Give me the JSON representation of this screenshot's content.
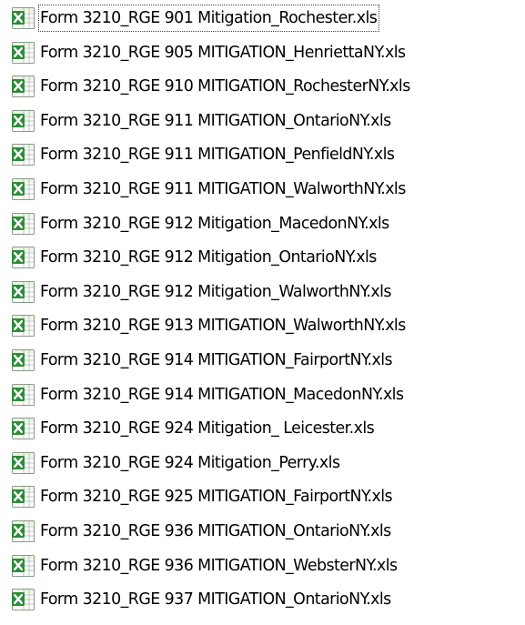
{
  "file_list": {
    "file_icon": "excel-spreadsheet-icon",
    "colors": {
      "icon_green": "#2e8b3a",
      "icon_light": "#eaf5e4",
      "text": "#000000"
    },
    "focused_index": 0,
    "items": [
      {
        "name": "Form 3210_RGE 901 Mitigation_Rochester.xls"
      },
      {
        "name": "Form 3210_RGE 905 MITIGATION_HenriettaNY.xls"
      },
      {
        "name": "Form 3210_RGE 910 MITIGATION_RochesterNY.xls"
      },
      {
        "name": "Form 3210_RGE 911 MITIGATION_OntarioNY.xls"
      },
      {
        "name": "Form 3210_RGE 911 MITIGATION_PenfieldNY.xls"
      },
      {
        "name": "Form 3210_RGE 911 MITIGATION_WalworthNY.xls"
      },
      {
        "name": "Form 3210_RGE 912 Mitigation_MacedonNY.xls"
      },
      {
        "name": "Form 3210_RGE 912 Mitigation_OntarioNY.xls"
      },
      {
        "name": "Form 3210_RGE 912 Mitigation_WalworthNY.xls"
      },
      {
        "name": "Form 3210_RGE 913 MITIGATION_WalworthNY.xls"
      },
      {
        "name": "Form 3210_RGE 914 MITIGATION_FairportNY.xls"
      },
      {
        "name": "Form 3210_RGE 914 MITIGATION_MacedonNY.xls"
      },
      {
        "name": "Form 3210_RGE 924 Mitigation_ Leicester.xls"
      },
      {
        "name": "Form 3210_RGE 924 Mitigation_Perry.xls"
      },
      {
        "name": "Form 3210_RGE 925 MITIGATION_FairportNY.xls"
      },
      {
        "name": "Form 3210_RGE 936 MITIGATION_OntarioNY.xls"
      },
      {
        "name": "Form 3210_RGE 936 MITIGATION_WebsterNY.xls"
      },
      {
        "name": "Form 3210_RGE 937 MITIGATION_OntarioNY.xls"
      }
    ]
  }
}
